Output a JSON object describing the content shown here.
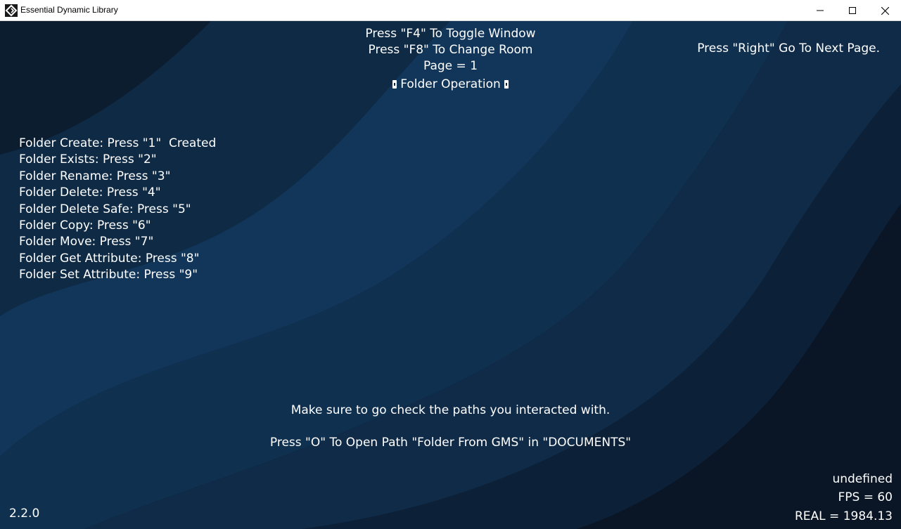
{
  "window": {
    "title": "Essential Dynamic Library"
  },
  "header": {
    "line1": "Press \"F4\" To Toggle Window",
    "line2": "Press \"F8\" To Change Room",
    "page": "Page = 1",
    "section": "Folder Operation",
    "next_page": "Press \"Right\" Go To Next Page."
  },
  "menu": {
    "items": [
      {
        "label": "Folder Create: Press \"1\"",
        "status": "Created"
      },
      {
        "label": "Folder Exists: Press \"2\""
      },
      {
        "label": "Folder Rename: Press \"3\""
      },
      {
        "label": "Folder Delete: Press \"4\""
      },
      {
        "label": "Folder Delete Safe: Press \"5\""
      },
      {
        "label": "Folder Copy: Press \"6\""
      },
      {
        "label": "Folder Move: Press \"7\""
      },
      {
        "label": "Folder Get Attribute: Press \"8\""
      },
      {
        "label": "Folder Set Attribute: Press \"9\""
      }
    ]
  },
  "footer": {
    "hint": "Make sure to go check the paths you interacted with.",
    "open_path": "Press \"O\" To Open Path \"Folder From GMS\" in \"DOCUMENTS\"",
    "version": "2.2.0",
    "debug_value": "undefined",
    "fps": "FPS = 60",
    "real": "REAL = 1984.13"
  },
  "colors": {
    "background_dark": "#0b1a2b",
    "background_mid": "#0f3150",
    "background_light": "#14406a",
    "text": "#ffffff"
  }
}
